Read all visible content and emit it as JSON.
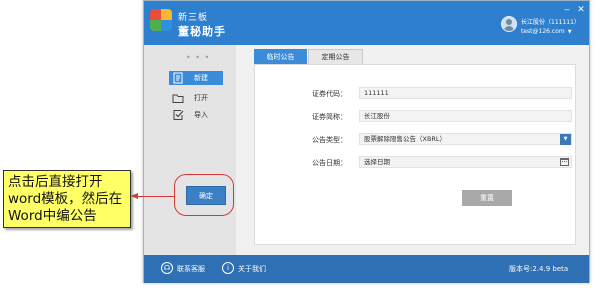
{
  "app": {
    "title_line1": "新三板",
    "title_line2": "董秘助手",
    "logo_colors": [
      "#e94b3c",
      "#f5b82e",
      "#4caf50",
      "#2f8fe0"
    ]
  },
  "user": {
    "name": "长江股份（111111）",
    "email": "test@126.com"
  },
  "window_controls": {
    "minimize": "‒",
    "close": "✕"
  },
  "sidebar": {
    "items": [
      {
        "label": "新建",
        "icon": "new-document-icon",
        "active": true
      },
      {
        "label": "打开",
        "icon": "folder-icon",
        "active": false
      },
      {
        "label": "导入",
        "icon": "import-check-icon",
        "active": false
      }
    ]
  },
  "tabs": [
    {
      "label": "临时公告",
      "active": true
    },
    {
      "label": "定期公告",
      "active": false
    }
  ],
  "form": {
    "code_label": "证券代码：",
    "code_value": "111111",
    "short_name_label": "证券简称：",
    "short_name_value": "长江股份",
    "type_label": "公告类型：",
    "type_value": "股票解除限售公告（XBRL）",
    "date_label": "公告日期：",
    "date_placeholder": "选择日期"
  },
  "buttons": {
    "confirm": "确定",
    "reset": "重置"
  },
  "status_bar": {
    "support": "联系客服",
    "about": "关于我们",
    "version": "版本号:2.4.9 beta"
  },
  "callout": {
    "text": "点击后直接打开word模板，然后在Word中编公告"
  },
  "colors": {
    "title_bar": "#2f7fcf",
    "status_bar": "#2f6fb3",
    "accent": "#3b8bd8",
    "annotation_red": "#d23a3a",
    "callout_bg": "#ffff66"
  }
}
